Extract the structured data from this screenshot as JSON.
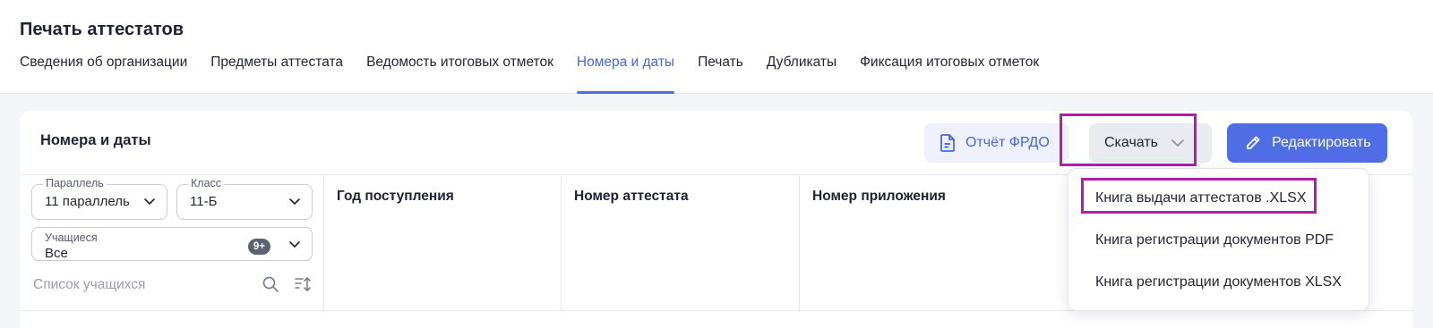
{
  "header": {
    "title": "Печать аттестатов",
    "tabs": [
      {
        "label": "Сведения об организации",
        "active": false
      },
      {
        "label": "Предметы аттестата",
        "active": false
      },
      {
        "label": "Ведомость итоговых отметок",
        "active": false
      },
      {
        "label": "Номера и даты",
        "active": true
      },
      {
        "label": "Печать",
        "active": false
      },
      {
        "label": "Дубликаты",
        "active": false
      },
      {
        "label": "Фиксация итоговых отметок",
        "active": false
      }
    ]
  },
  "card": {
    "title": "Номера и даты",
    "report_button": "Отчёт ФРДО",
    "download_button": "Скачать",
    "edit_button": "Редактировать"
  },
  "filters": {
    "parallel": {
      "label": "Параллель",
      "value": "11 параллель"
    },
    "class": {
      "label": "Класс",
      "value": "11-Б"
    },
    "students": {
      "label": "Учащиеся",
      "value": "Все",
      "badge": "9+"
    },
    "student_list_placeholder": "Список учащихся"
  },
  "table": {
    "columns": [
      "Год поступления",
      "Номер аттестата",
      "Номер приложения"
    ]
  },
  "download_menu": {
    "items": [
      "Книга выдачи аттестатов .XLSX",
      "Книга регистрации документов PDF",
      "Книга регистрации документов XLSX"
    ]
  },
  "colors": {
    "accent": "#4f6ee6",
    "highlight": "#b21ea9",
    "accent_soft": "#eef1fc"
  }
}
